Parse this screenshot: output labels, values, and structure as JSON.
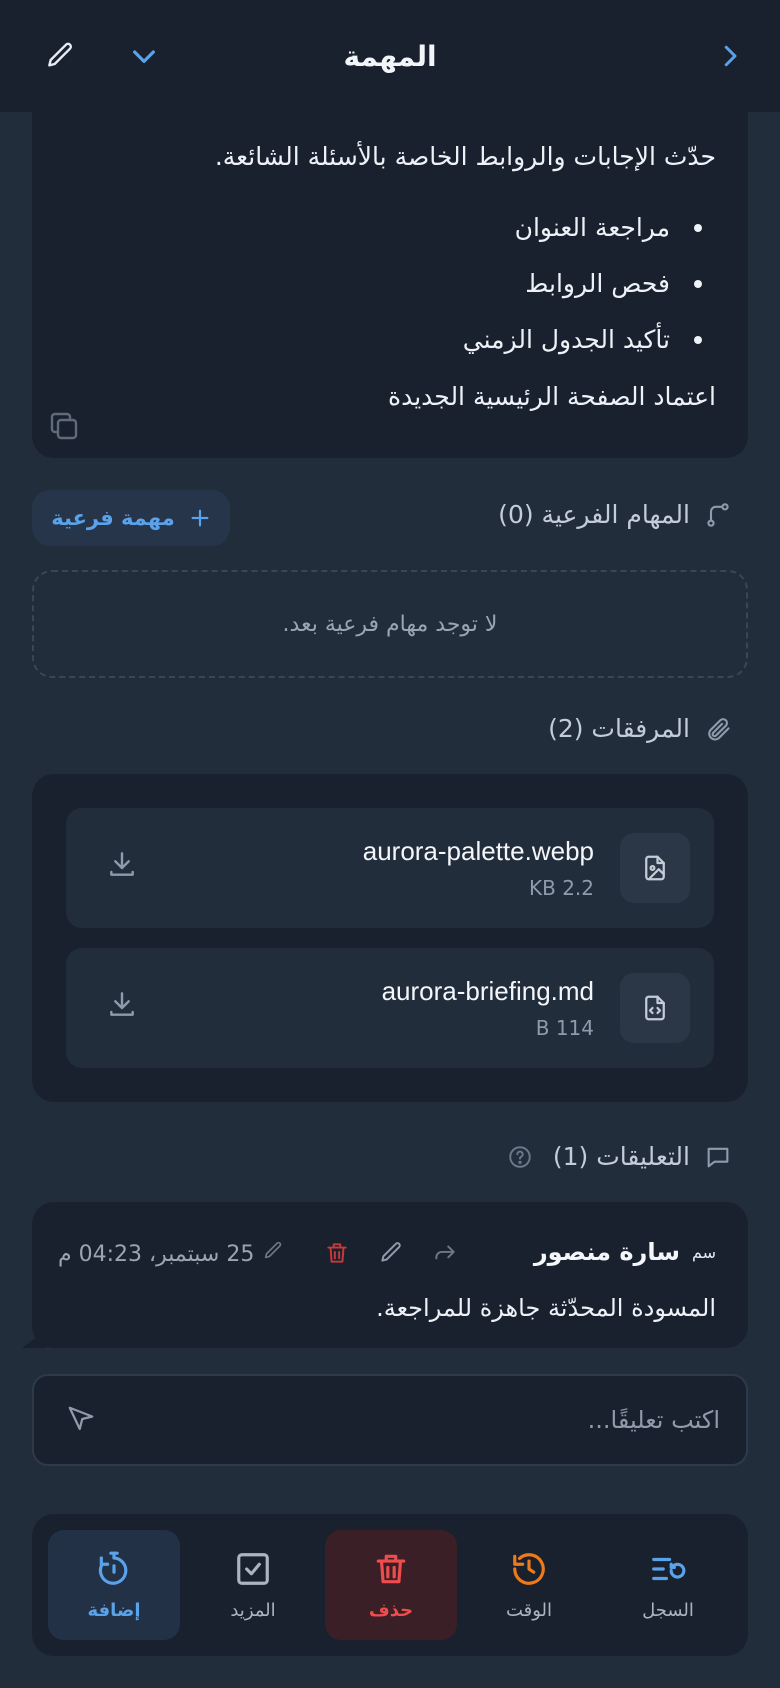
{
  "header": {
    "title": "المهمة"
  },
  "description": {
    "cut_text": "ـ ـ ـ",
    "lead": "حدّث الإجابات والروابط الخاصة بالأسئلة الشائعة.",
    "bullets": [
      "مراجعة العنوان",
      "فحص الروابط",
      "تأكيد الجدول الزمني"
    ],
    "final": "اعتماد الصفحة الرئيسية الجديدة"
  },
  "subtasks": {
    "heading": "المهام الفرعية (0)",
    "add_label": "مهمة فرعية",
    "empty_text": "لا توجد مهام فرعية بعد."
  },
  "attachments": {
    "heading": "المرفقات (2)",
    "files": [
      {
        "name": "aurora-palette.webp",
        "size": "KB 2.2",
        "icon": "image-file-icon"
      },
      {
        "name": "aurora-briefing.md",
        "size": "B 114",
        "icon": "code-file-icon"
      }
    ]
  },
  "comments": {
    "heading": "التعليقات (1)",
    "items": [
      {
        "initials": "سم",
        "author": "سارة منصور",
        "date": "25 سبتمبر، 04:23 م",
        "body": "المسودة المحدّثة جاهزة للمراجعة."
      }
    ],
    "input_placeholder": "اكتب تعليقًا..."
  },
  "toolbar": {
    "add": "إضافة",
    "more": "المزيد",
    "delete": "حذف",
    "time": "الوقت",
    "log": "السجل"
  },
  "colors": {
    "background": "#222d3c",
    "card": "#18212d",
    "accent": "#5aa2ea",
    "danger": "#ef4d4d",
    "warning": "#f07a1a"
  }
}
